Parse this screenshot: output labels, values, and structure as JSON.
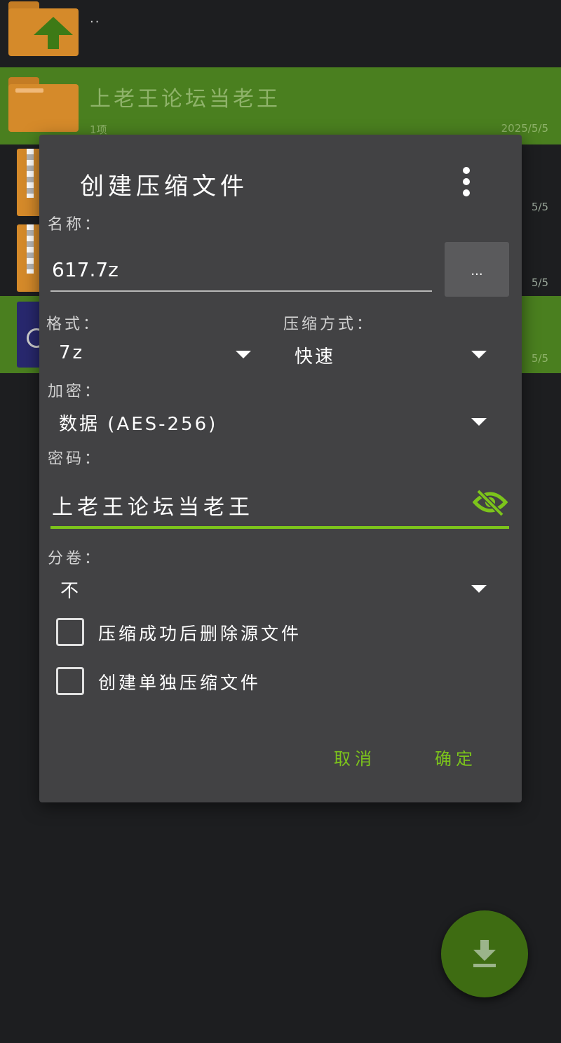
{
  "file_list": {
    "parent_row": {
      "label": ".."
    },
    "selected_folder": {
      "name": "上老王论坛当老王",
      "meta_left": "1项",
      "date": "2025/5/5"
    },
    "rows": [
      {
        "date": "5/5"
      },
      {
        "date": "5/5"
      },
      {
        "date": "5/5"
      }
    ]
  },
  "dialog": {
    "title": "创建压缩文件",
    "more_icon": "more-vert-icon",
    "name_label": "名称：",
    "name_value": "617.7z",
    "browse_label": "...",
    "format_label": "格式：",
    "format_value": "7z",
    "method_label": "压缩方式：",
    "method_value": "快速",
    "encrypt_label": "加密：",
    "encrypt_value": "数据 (AES-256)",
    "password_label": "密码：",
    "password_value": "上老王论坛当老王",
    "visibility_icon": "eye-off-icon",
    "split_label": "分卷：",
    "split_value": "不",
    "delete_source_label": "压缩成功后删除源文件",
    "delete_source_checked": false,
    "separate_archive_label": "创建单独压缩文件",
    "separate_archive_checked": false,
    "cancel_label": "取消",
    "ok_label": "确定"
  },
  "fab": {
    "icon": "download-icon"
  },
  "colors": {
    "accent": "#7cc41b",
    "selected_row": "#4a7f1f",
    "dialog_bg": "#424244",
    "fab": "#3e6c12"
  }
}
